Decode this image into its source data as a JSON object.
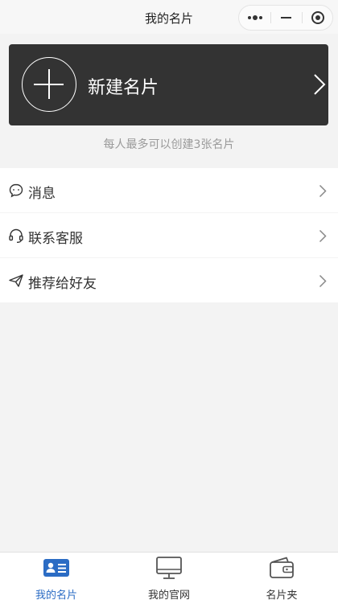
{
  "header": {
    "title": "我的名片",
    "capsule": {
      "more_icon": "more-dots-icon",
      "minimize_icon": "minus-icon",
      "close_icon": "target-icon"
    }
  },
  "new_card": {
    "label": "新建名片",
    "icon": "plus-circle-icon",
    "arrow_icon": "chevron-right-icon",
    "background": "#333333"
  },
  "limit_note": "每人最多可以创建3张名片",
  "menu": {
    "items": [
      {
        "label": "消息",
        "icon": "chat-bubble-icon"
      },
      {
        "label": "联系客服",
        "icon": "headset-icon"
      },
      {
        "label": "推荐给好友",
        "icon": "paper-plane-icon"
      }
    ]
  },
  "tabbar": {
    "tabs": [
      {
        "label": "我的名片",
        "icon": "business-card-icon",
        "active": true
      },
      {
        "label": "我的官网",
        "icon": "monitor-icon",
        "active": false
      },
      {
        "label": "名片夹",
        "icon": "wallet-icon",
        "active": false
      }
    ],
    "active_color": "#2b6cc4"
  }
}
